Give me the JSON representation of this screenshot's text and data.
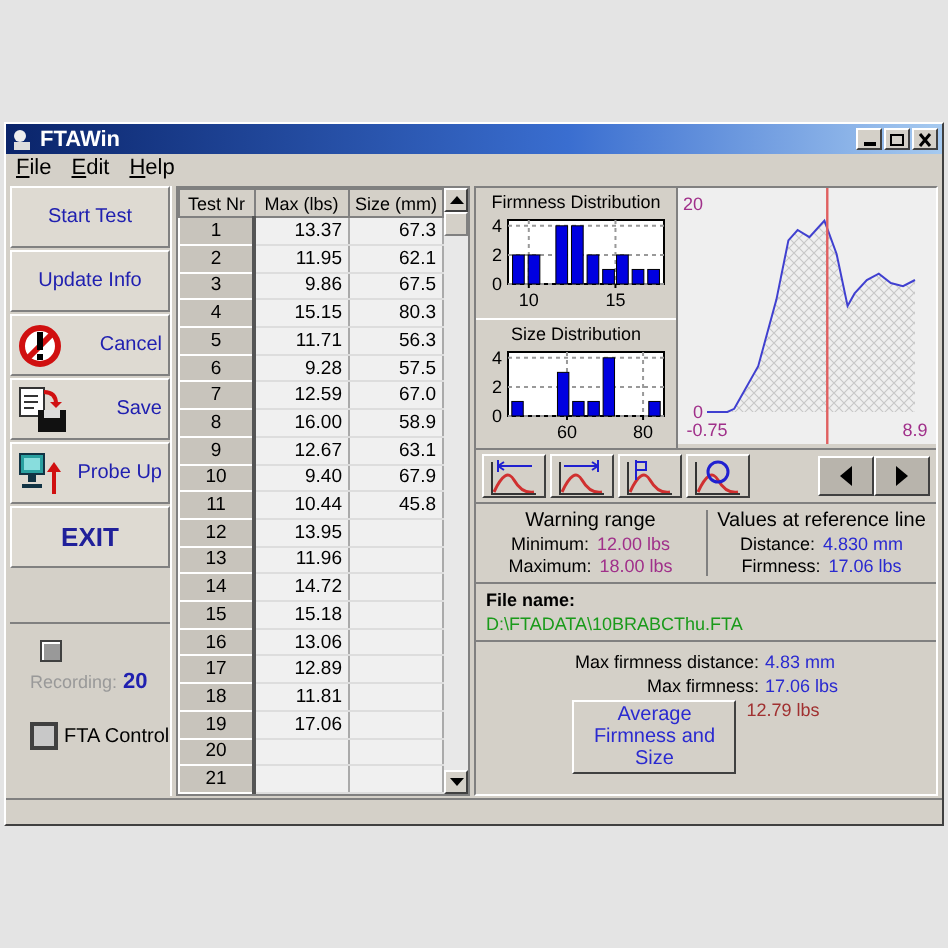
{
  "window": {
    "title": "FTAWin"
  },
  "menu": [
    "File",
    "Edit",
    "Help"
  ],
  "side_buttons": [
    {
      "label": "Start Test",
      "kind": "text"
    },
    {
      "label": "Update Info",
      "kind": "text"
    },
    {
      "label": "Cancel",
      "kind": "no-entry"
    },
    {
      "label": "Save",
      "kind": "save"
    },
    {
      "label": "Probe Up",
      "kind": "probe"
    },
    {
      "label": "EXIT",
      "kind": "strong"
    }
  ],
  "recording": {
    "label": "Recording:",
    "value": "20"
  },
  "fta_control": {
    "label": "FTA Control",
    "checked": false
  },
  "table": {
    "columns": [
      "Test Nr",
      "Max (lbs)",
      "Size (mm)"
    ],
    "rows": [
      [
        "1",
        "13.37",
        "67.3"
      ],
      [
        "2",
        "11.95",
        "62.1"
      ],
      [
        "3",
        "9.86",
        "67.5"
      ],
      [
        "4",
        "15.15",
        "80.3"
      ],
      [
        "5",
        "11.71",
        "56.3"
      ],
      [
        "6",
        "9.28",
        "57.5"
      ],
      [
        "7",
        "12.59",
        "67.0"
      ],
      [
        "8",
        "16.00",
        "58.9"
      ],
      [
        "9",
        "12.67",
        "63.1"
      ],
      [
        "10",
        "9.40",
        "67.9"
      ],
      [
        "11",
        "10.44",
        "45.8"
      ],
      [
        "12",
        "13.95",
        ""
      ],
      [
        "13",
        "11.96",
        ""
      ],
      [
        "14",
        "14.72",
        ""
      ],
      [
        "15",
        "15.18",
        ""
      ],
      [
        "16",
        "13.06",
        ""
      ],
      [
        "17",
        "12.89",
        ""
      ],
      [
        "18",
        "11.81",
        ""
      ],
      [
        "19",
        "17.06",
        ""
      ],
      [
        "20",
        "",
        ""
      ],
      [
        "21",
        "",
        ""
      ]
    ]
  },
  "firmness_distribution": {
    "chart_data": {
      "type": "bar",
      "title": "Firmness Distribution",
      "x": [
        9.4,
        10.3,
        11.2,
        11.9,
        12.8,
        13.7,
        14.6,
        15.4,
        16.3,
        17.2
      ],
      "values": [
        2,
        2,
        0,
        4,
        4,
        2,
        1,
        2,
        1,
        1
      ],
      "xlim": [
        8.8,
        17.8
      ],
      "ylim": [
        0,
        4.4
      ],
      "xticks": [
        10,
        15
      ],
      "yticks": [
        0,
        2,
        4
      ],
      "grid": true
    }
  },
  "size_distribution": {
    "chart_data": {
      "type": "bar",
      "title": "Size Distribution",
      "x": [
        47,
        51,
        55,
        59,
        63,
        67,
        71,
        75,
        79,
        83
      ],
      "values": [
        1,
        0,
        0,
        3,
        1,
        1,
        4,
        0,
        0,
        1
      ],
      "xlim": [
        44.5,
        85.5
      ],
      "ylim": [
        0,
        4.4
      ],
      "xticks": [
        60,
        80
      ],
      "yticks": [
        0,
        2,
        4
      ],
      "grid": true
    }
  },
  "firmness_curve": {
    "chart_data": {
      "type": "area",
      "x": [
        -0.75,
        0.2,
        0.51,
        1.63,
        2.47,
        3.03,
        3.45,
        4.0,
        4.7,
        5.26,
        5.77,
        6.1,
        6.66,
        7.22,
        7.78,
        8.34,
        8.9
      ],
      "values": [
        0,
        0,
        0.3,
        4.4,
        10.8,
        16.5,
        17.5,
        16.8,
        18.4,
        15.2,
        10.2,
        11.4,
        12.7,
        13.3,
        12.4,
        12.1,
        12.7
      ],
      "xlim": [
        -0.75,
        8.9
      ],
      "ylim": [
        0,
        20
      ],
      "xticks": [
        -0.75,
        8.9
      ],
      "yticks": [
        0,
        20
      ],
      "ref_lines": [
        {
          "axis": "x",
          "value": 4.83
        }
      ]
    }
  },
  "tool_buttons": [
    {
      "kind": "left"
    },
    {
      "kind": "right"
    },
    {
      "kind": "flag"
    },
    {
      "kind": "magnify"
    }
  ],
  "nav_buttons": [
    {
      "kind": "prev"
    },
    {
      "kind": "next"
    }
  ],
  "warning_range": {
    "title": "Warning range",
    "rows": [
      {
        "label": "Minimum:",
        "value": "12.00 lbs"
      },
      {
        "label": "Maximum:",
        "value": "18.00 lbs"
      }
    ]
  },
  "reference_values": {
    "title": "Values at reference line",
    "rows": [
      {
        "label": "Distance:",
        "value": "4.830 mm"
      },
      {
        "label": "Firmness:",
        "value": "17.06 lbs"
      }
    ]
  },
  "file": {
    "label": "File name:",
    "path": "D:\\FTADATA\\10BRABCThu.FTA"
  },
  "results": [
    {
      "label": "Max firmness distance:",
      "value": "4.83 mm"
    },
    {
      "label": "Max firmness:",
      "value": "17.06 lbs"
    }
  ],
  "average": {
    "button": "Average Firmness and Size",
    "value": "12.79 lbs"
  }
}
